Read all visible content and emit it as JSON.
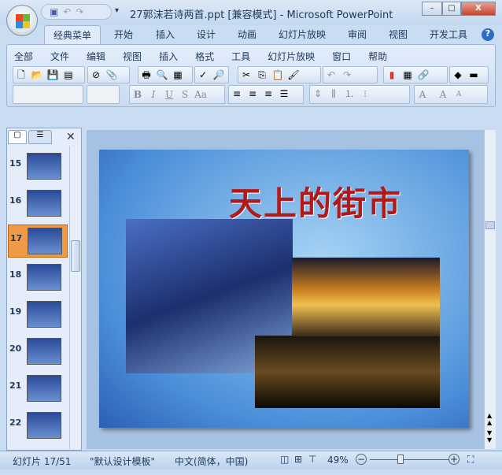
{
  "window": {
    "title": "27郭沫若诗两首.ppt [兼容模式] - Microsoft PowerPoint",
    "minimize": "–",
    "maximize": "□",
    "close": "X"
  },
  "tabs": [
    "经典菜单",
    "开始",
    "插入",
    "设计",
    "动画",
    "幻灯片放映",
    "审阅",
    "视图",
    "开发工具"
  ],
  "help_icon": "?",
  "menu": [
    "全部",
    "文件",
    "编辑",
    "视图",
    "插入",
    "格式",
    "工具",
    "幻灯片放映",
    "窗口",
    "帮助"
  ],
  "format_buttons": [
    "B",
    "I",
    "U",
    "S",
    "Aa"
  ],
  "font_buttons": [
    "A",
    "A",
    "A"
  ],
  "thumbnails": [
    {
      "n": "15"
    },
    {
      "n": "16"
    },
    {
      "n": "17",
      "selected": true
    },
    {
      "n": "18"
    },
    {
      "n": "19"
    },
    {
      "n": "20"
    },
    {
      "n": "21"
    },
    {
      "n": "22"
    }
  ],
  "slide": {
    "title": "天上的街市"
  },
  "status": {
    "slide": "幻灯片 17/51",
    "template": "\"默认设计模板\"",
    "language": "中文(简体，中国)",
    "zoom": "49%",
    "zoom_percent": 49
  }
}
